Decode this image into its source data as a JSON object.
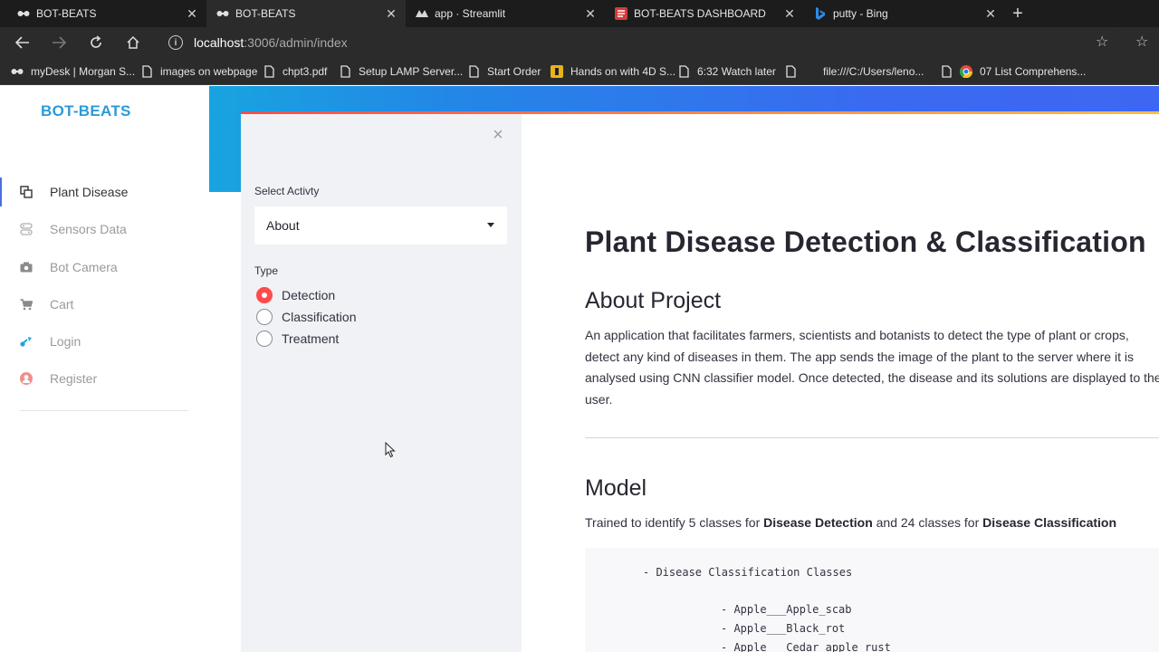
{
  "browser": {
    "tabs": [
      {
        "title": "BOT-BEATS",
        "icon": "bot-beats-icon",
        "active": false
      },
      {
        "title": "BOT-BEATS",
        "icon": "bot-beats-icon",
        "active": true
      },
      {
        "title": "app · Streamlit",
        "icon": "streamlit-icon",
        "active": false
      },
      {
        "title": "BOT-BEATS DASHBOARD",
        "icon": "dashboard-icon",
        "active": false
      },
      {
        "title": "putty - Bing",
        "icon": "bing-icon",
        "active": false
      }
    ],
    "address": {
      "host": "localhost",
      "path": ":3006/admin/index"
    },
    "bookmarks": [
      {
        "label": "myDesk | Morgan S..."
      },
      {
        "label": "images on webpage"
      },
      {
        "label": "chpt3.pdf"
      },
      {
        "label": "Setup LAMP Server..."
      },
      {
        "label": "Start Order"
      },
      {
        "label": "Hands on with 4D S..."
      },
      {
        "label": "6:32 Watch later"
      },
      {
        "label": "file:///C:/Users/leno..."
      },
      {
        "label": "07 List Comprehens..."
      }
    ]
  },
  "sidebar": {
    "brand": "BOT-BEATS",
    "items": [
      {
        "label": "Plant Disease",
        "icon": "plant-disease-icon",
        "active": true
      },
      {
        "label": "Sensors Data",
        "icon": "sensors-icon",
        "active": false
      },
      {
        "label": "Bot Camera",
        "icon": "camera-icon",
        "active": false
      },
      {
        "label": "Cart",
        "icon": "cart-icon",
        "active": false
      },
      {
        "label": "Login",
        "icon": "login-icon",
        "active": false
      },
      {
        "label": "Register",
        "icon": "register-icon",
        "active": false
      }
    ]
  },
  "streamlit": {
    "select_label": "Select Activty",
    "select_value": "About",
    "type_label": "Type",
    "radio_options": [
      {
        "label": "Detection",
        "checked": true
      },
      {
        "label": "Classification",
        "checked": false
      },
      {
        "label": "Treatment",
        "checked": false
      }
    ]
  },
  "main": {
    "title": "Plant Disease Detection & Classification",
    "about_heading": "About Project",
    "about_text": "An application that facilitates farmers, scientists and botanists to detect the type of plant or crops, detect any kind of diseases in them. The app sends the image of the plant to the server where it is analysed using CNN classifier model. Once detected, the disease and its solutions are displayed to the user.",
    "model_heading": "Model",
    "model_prefix": "Trained to identify 5 classes for ",
    "model_bold1": "Disease Detection",
    "model_middle": " and 24 classes for ",
    "model_bold2": "Disease Classification",
    "code_heading": "- Disease Classification Classes",
    "code_items": [
      "- Apple___Apple_scab",
      "- Apple___Black_rot",
      "- Apple___Cedar_apple_rust"
    ]
  },
  "colors": {
    "brand": "#2c9ad8",
    "accent": "#ff4b4b",
    "banner_start": "#18a4e0",
    "banner_end": "#3d67f2"
  }
}
